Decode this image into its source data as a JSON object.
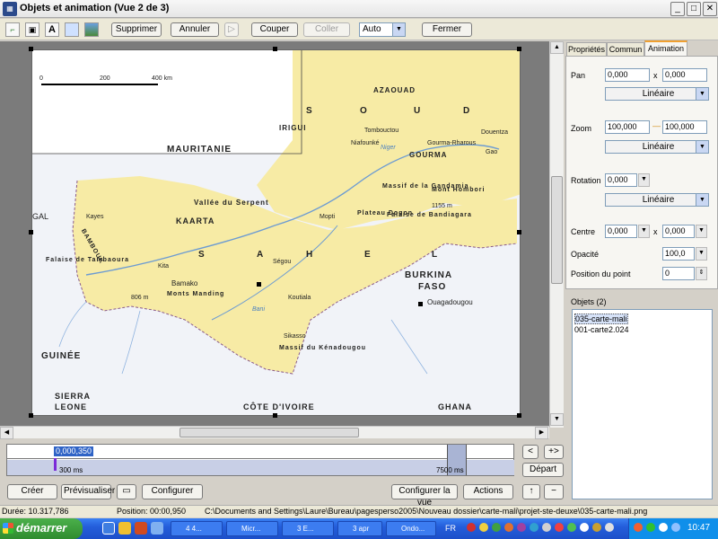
{
  "window": {
    "title": "Objets et animation  (Vue 2 de 3)",
    "min": "_",
    "max": "□",
    "close": "✕",
    "icon": "app-icon"
  },
  "toolbar": {
    "supprimer": "Supprimer",
    "annuler": "Annuler",
    "couper": "Couper",
    "coller": "Coller",
    "mode_value": "Auto",
    "fermer": "Fermer",
    "icons": [
      "crop-icon",
      "image-icon",
      "text-icon",
      "rectangle-icon",
      "picture-icon"
    ]
  },
  "map": {
    "scale": {
      "zero": "0",
      "mid": "200",
      "end": "400 km"
    },
    "labels": {
      "mauritanie": "MAURITANIE",
      "azaouad": "AZAOUAD",
      "irigui": "IRIGUI",
      "s": "S",
      "o": "O",
      "u": "U",
      "d": "D",
      "tombouctou": "Tombouctou",
      "gourma_rharous": "Gourma-Rharous",
      "douentza": "Douentza",
      "gourma": "GOURMA",
      "niafounke": "Niafounké",
      "gao": "Gao",
      "vallee_serpent": "Vallée du Serpent",
      "kaarta": "KAARTA",
      "kayes": "Kayes",
      "mopti": "Mopti",
      "gao2": "Massif de la Gandamia",
      "hombori": "Mont Hombori",
      "hombori_alt": "1155 m",
      "plateau": "Plateau Dogon",
      "falaise_bandiagara": "Falaise de Bandiagara",
      "bambouk": "BAMBOUK",
      "falaise_tambaoura": "Falaise de Tambaoura",
      "sahel_s": "S",
      "sahel_a": "A",
      "sahel_h": "H",
      "sahel_e": "E",
      "sahel_l": "L",
      "segou": "Ségou",
      "kita": "Kita",
      "bamako": "Bamako",
      "monts_manding": "Monts Manding",
      "alt_806": "806 m",
      "koutiala": "Koutiala",
      "sikasso": "Sikasso",
      "massif_kenadougou": "Massif du Kénadougou",
      "burkina": "BURKINA",
      "faso": "FASO",
      "ouagadougou": "Ouagadougou",
      "guinee": "GUINÉE",
      "sierra_leone_1": "SIERRA",
      "sierra_leone_2": "LEONE",
      "cote_ivoire": "CÔTE D'IVOIRE",
      "ghana": "GHANA",
      "gal": "GAL",
      "niger_river": "Niger",
      "bani": "Bani"
    }
  },
  "panel": {
    "tabs": [
      "Propriétés",
      "Commun",
      "Animation"
    ],
    "pan_label": "Pan",
    "pan_x": "0,000",
    "pan_y": "0,000",
    "pan_interp": "Linéaire",
    "zoom_label": "Zoom",
    "zoom_x": "100,000",
    "zoom_y": "100,000",
    "zoom_interp": "Linéaire",
    "rotation_label": "Rotation",
    "rotation_value": "0,000",
    "rotation_interp": "Linéaire",
    "centre_label": "Centre",
    "centre_x": "0,000",
    "centre_y": "0,000",
    "opacite_label": "Opacité",
    "opacite_value": "100,0",
    "position_label": "Position du point",
    "position_value": "0",
    "x_sep": "x"
  },
  "objects": {
    "title": "Objets (2)",
    "items": [
      "035-carte-mali",
      "001-carte2.024"
    ]
  },
  "timeline": {
    "current": "0,000,350",
    "start_marker": "300 ms",
    "end_marker": "7500 ms",
    "depart": "Départ",
    "prev": "<",
    "add": "+>",
    "up": "↑",
    "minus": "−"
  },
  "bottom": {
    "creer": "Créer",
    "previsualiser": "Prévisualiser",
    "configurer": "Configurer",
    "configurer_lacte": "Configurer la vue",
    "actions": "Actions"
  },
  "status": {
    "duree": "Durée: 10.317,786",
    "position": "Position: 00:00,950",
    "path": "C:\\Documents and Settings\\Laure\\Bureau\\pagesperso2005\\Nouveau dossier\\carte-mali\\projet-ste-deuxe\\035-carte-mali.png"
  },
  "taskbar": {
    "start": "démarrer",
    "items": [
      "4 4...",
      "Micr...",
      "3 E...",
      "3 apr",
      "Ondo...",
      "FR"
    ],
    "clock": "10:47"
  }
}
